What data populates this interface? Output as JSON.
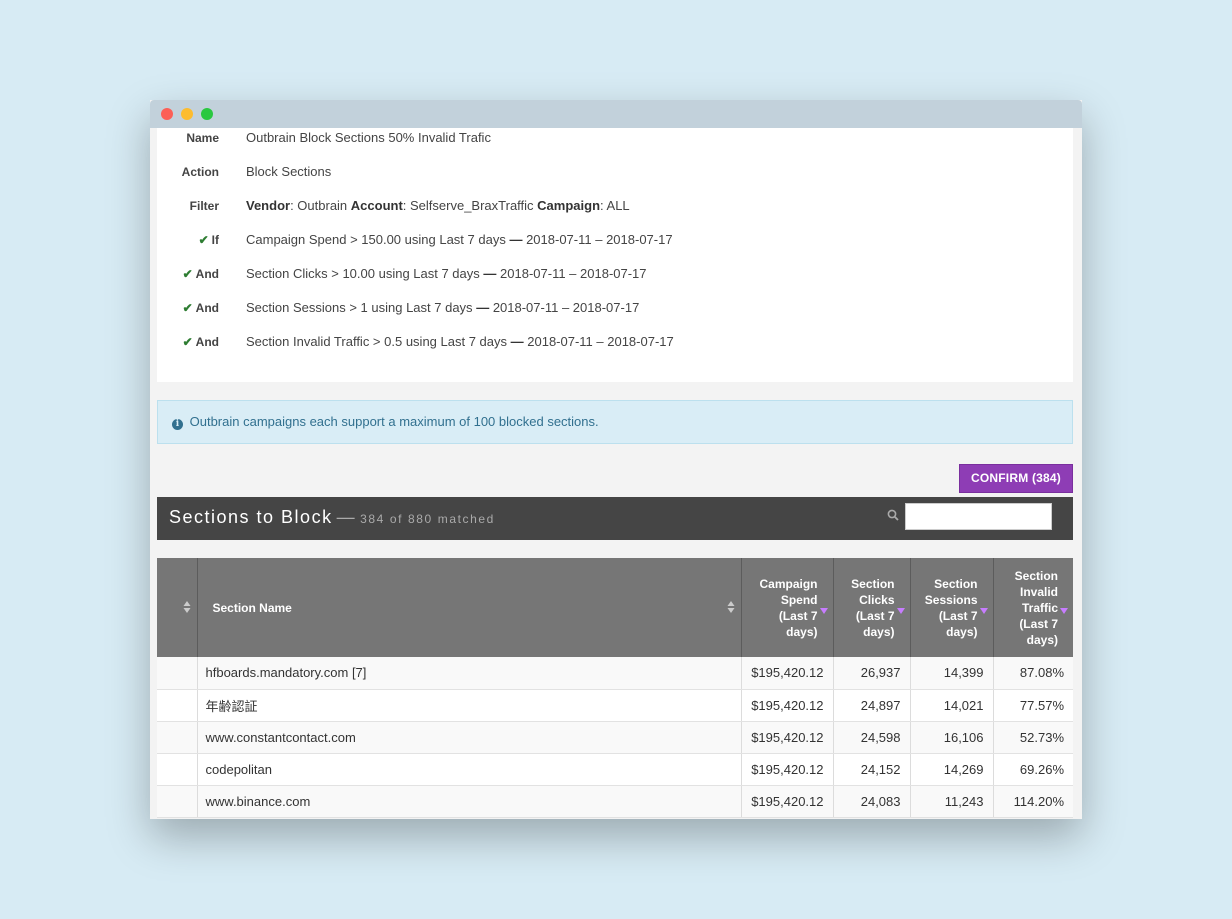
{
  "rule": {
    "name_label": "Name",
    "name_value": "Outbrain Block Sections 50% Invalid Trafic",
    "action_label": "Action",
    "action_value": "Block Sections",
    "filter_label": "Filter",
    "filter": {
      "vendor_key": "Vendor",
      "vendor_value": ": Outbrain ",
      "account_key": "Account",
      "account_value": ": Selfserve_BraxTraffic ",
      "campaign_key": "Campaign",
      "campaign_value": ": ALL"
    },
    "conditions": [
      {
        "label": "If",
        "text": "Campaign Spend > 150.00 using Last 7 days",
        "range": "2018-07-11 – 2018-07-17"
      },
      {
        "label": "And",
        "text": "Section Clicks > 10.00 using Last 7 days",
        "range": "2018-07-11 – 2018-07-17"
      },
      {
        "label": "And",
        "text": "Section Sessions > 1 using Last 7 days",
        "range": "2018-07-11 – 2018-07-17"
      },
      {
        "label": "And",
        "text": "Section Invalid Traffic > 0.5 using Last 7 days",
        "range": "2018-07-11 – 2018-07-17"
      }
    ],
    "dash": "—"
  },
  "info": {
    "text": "Outbrain campaigns each support a maximum of 100 blocked sections."
  },
  "confirm_label": "CONFIRM (384)",
  "table_header": {
    "title": "Sections to Block",
    "dash": "—",
    "subtitle": "384 of 880 matched",
    "search_value": ""
  },
  "columns": {
    "section_name": "Section Name",
    "campaign_spend": [
      "Campaign",
      "Spend",
      "(Last 7",
      "days)"
    ],
    "section_clicks": [
      "Section",
      "Clicks",
      "(Last 7",
      "days)"
    ],
    "section_sessions": [
      "Section",
      "Sessions",
      "(Last 7",
      "days)"
    ],
    "section_invalid": [
      "Section",
      "Invalid",
      "Traffic",
      "(Last 7",
      "days)"
    ]
  },
  "rows": [
    {
      "name": "hfboards.mandatory.com [7]",
      "spend": "$195,420.12",
      "clicks": "26,937",
      "sessions": "14,399",
      "invalid": "87.08%"
    },
    {
      "name": "年齢認証",
      "spend": "$195,420.12",
      "clicks": "24,897",
      "sessions": "14,021",
      "invalid": "77.57%"
    },
    {
      "name": "www.constantcontact.com",
      "spend": "$195,420.12",
      "clicks": "24,598",
      "sessions": "16,106",
      "invalid": "52.73%"
    },
    {
      "name": "codepolitan",
      "spend": "$195,420.12",
      "clicks": "24,152",
      "sessions": "14,269",
      "invalid": "69.26%"
    },
    {
      "name": "www.binance.com",
      "spend": "$195,420.12",
      "clicks": "24,083",
      "sessions": "11,243",
      "invalid": "114.20%"
    }
  ],
  "colors": {
    "confirm": "#8e3db5",
    "header_bar": "#454545",
    "column_header": "#767676",
    "info_bg": "#d9edf6",
    "check": "#2e7d32",
    "sort_active": "#c77dff"
  }
}
